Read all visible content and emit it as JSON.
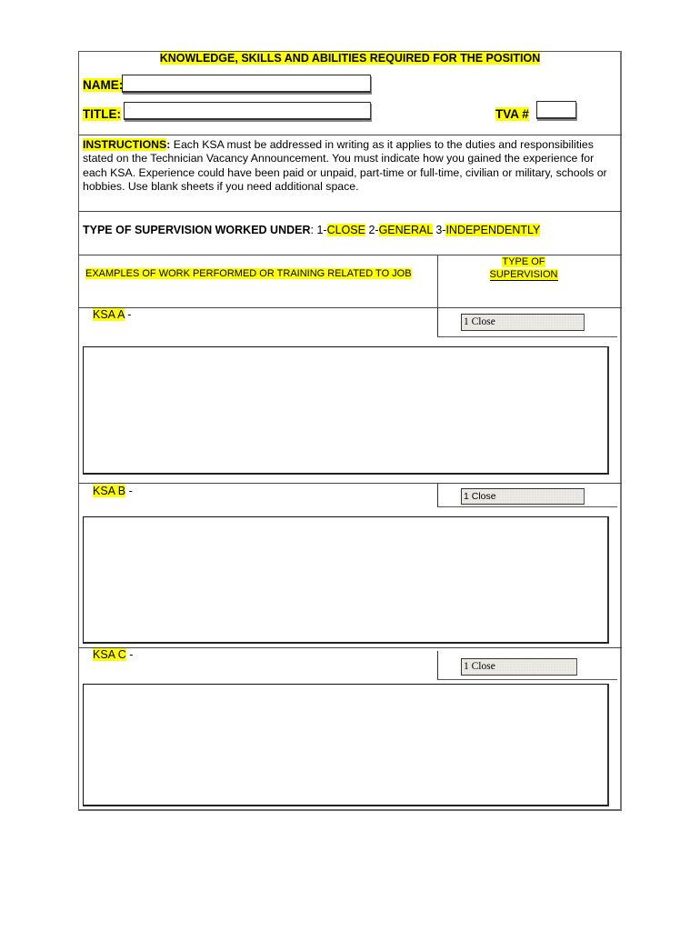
{
  "form": {
    "title": "KNOWLEDGE, SKILLS AND ABILITIES REQUIRED FOR THE POSITION",
    "name_label": "NAME:",
    "name_value": "",
    "title_label": "TITLE:",
    "title_value": "",
    "tva_label": "TVA #",
    "tva_value": ""
  },
  "instructions": {
    "label": "INSTRUCTIONS",
    "colon": ":",
    "text": " Each KSA must be addressed in writing as it applies to the duties and responsibilities stated on the Technician Vacancy Announcement.  You must indicate how you gained the experience for each KSA.  Experience could have been paid or unpaid, part-time or full-time, civilian or military, schools or hobbies.  Use blank sheets if you need additional space."
  },
  "supervision": {
    "label": "TYPE OF SUPERVISION WORKED UNDER",
    "colon": ": ",
    "options": [
      {
        "num": "1-",
        "text": "CLOSE"
      },
      {
        "num": " 2-",
        "text": "GENERAL"
      },
      {
        "num": " 3-",
        "text": "INDEPENDENTLY"
      }
    ]
  },
  "columns": {
    "examples_header": "EXAMPLES OF WORK PERFORMED OR TRAINING RELATED TO JOB",
    "type_header_line1": "TYPE OF",
    "type_header_line2": "SUPERVISION"
  },
  "ksas": [
    {
      "label": "KSA A",
      "dash": " -",
      "supervision_value": "1 Close",
      "response": ""
    },
    {
      "label": "KSA B",
      "dash": " -",
      "supervision_value": "1 Close",
      "response": ""
    },
    {
      "label": "KSA C",
      "dash": " -",
      "supervision_value": "1 Close",
      "response": ""
    }
  ]
}
